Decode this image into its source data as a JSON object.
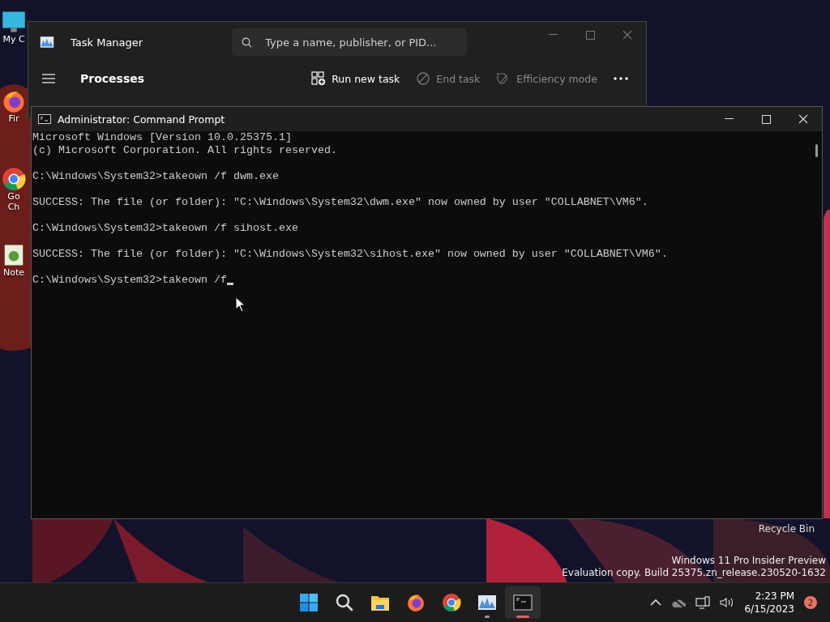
{
  "desktop_icons": [
    {
      "label": "My C",
      "kind": "computer"
    },
    {
      "label": "Fir",
      "kind": "firefox"
    },
    {
      "label": "Go",
      "label2": "Ch",
      "kind": "chrome"
    },
    {
      "label": "Note",
      "kind": "notepad"
    }
  ],
  "recycle_bin": {
    "label": "Recycle Bin"
  },
  "watermark_text": [
    "Windows 11 Pro Insider Preview",
    "Evaluation copy. Build 25375.zn_release.230520-1632"
  ],
  "task_manager": {
    "title": "Task Manager",
    "search": {
      "placeholder": "Type a name, publisher, or PID..."
    },
    "page": "Processes",
    "toolbar": [
      {
        "label": "Run new task",
        "kind": "run",
        "disabled": false
      },
      {
        "label": "End task",
        "kind": "end",
        "disabled": true
      },
      {
        "label": "Efficiency mode",
        "kind": "leaf",
        "disabled": true
      }
    ]
  },
  "command_prompt": {
    "title": "Administrator: Command Prompt",
    "blocks": [
      [
        "Microsoft Windows [Version 10.0.25375.1]",
        "(c) Microsoft Corporation. All rights reserved."
      ],
      [
        "C:\\Windows\\System32>takeown /f dwm.exe"
      ],
      [
        "SUCCESS: The file (or folder): \"C:\\Windows\\System32\\dwm.exe\" now owned by user \"COLLABNET\\VM6\"."
      ],
      [
        "C:\\Windows\\System32>takeown /f sihost.exe"
      ],
      [
        "SUCCESS: The file (or folder): \"C:\\Windows\\System32\\sihost.exe\" now owned by user \"COLLABNET\\VM6\"."
      ]
    ],
    "input_line": "C:\\Windows\\System32>takeown /f"
  },
  "taskbar": {
    "apps": [
      {
        "kind": "start",
        "running": false,
        "selected": false
      },
      {
        "kind": "search",
        "running": false,
        "selected": false
      },
      {
        "kind": "folder",
        "running": false,
        "selected": false
      },
      {
        "kind": "firefox",
        "running": false,
        "selected": false
      },
      {
        "kind": "chrome",
        "running": false,
        "selected": false
      },
      {
        "kind": "taskmgr",
        "running": true,
        "selected": false
      },
      {
        "kind": "terminal",
        "running": true,
        "selected": true
      }
    ],
    "time": "2:23 PM",
    "date": "6/15/2023",
    "notification_count": "2"
  }
}
